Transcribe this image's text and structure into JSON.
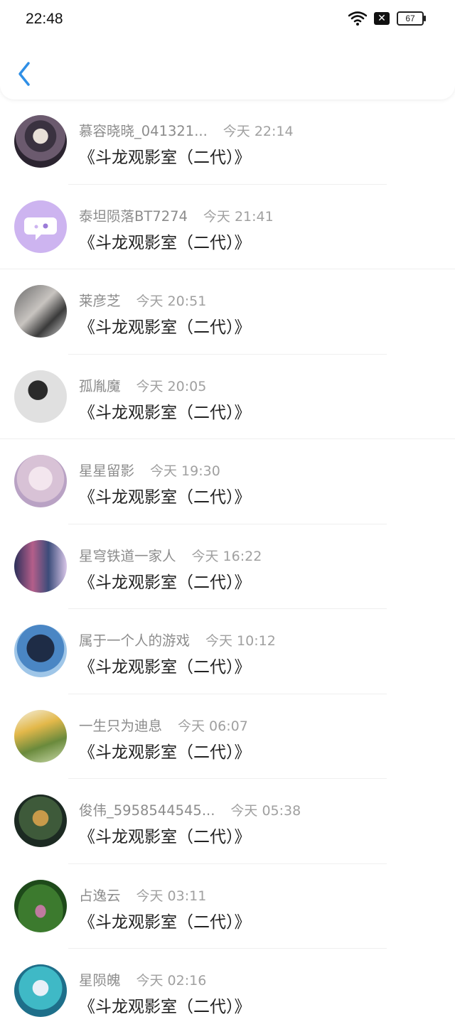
{
  "status_bar": {
    "time": "22:48",
    "battery": "67"
  },
  "header": {
    "back_icon": "chevron-left-icon",
    "accent_color": "#2f8fe6"
  },
  "comments": [
    {
      "name": "慕容晓晓_041321...",
      "time": "今天 22:14",
      "title": "《斗龙观影室（二代）》"
    },
    {
      "name": "泰坦陨落BT7274",
      "time": "今天 21:41",
      "title": "《斗龙观影室（二代）》"
    },
    {
      "name": "莱彦芝",
      "time": "今天 20:51",
      "title": "《斗龙观影室（二代）》"
    },
    {
      "name": "孤胤魔",
      "time": "今天 20:05",
      "title": "《斗龙观影室（二代）》"
    },
    {
      "name": "星星留影",
      "time": "今天 19:30",
      "title": "《斗龙观影室（二代）》"
    },
    {
      "name": "星穹铁道一家人",
      "time": "今天 16:22",
      "title": "《斗龙观影室（二代）》"
    },
    {
      "name": "属于一个人的游戏",
      "time": "今天 10:12",
      "title": "《斗龙观影室（二代）》"
    },
    {
      "name": "一生只为迪息",
      "time": "今天 06:07",
      "title": "《斗龙观影室（二代）》"
    },
    {
      "name": "俊伟_5958544545...",
      "time": "今天 05:38",
      "title": "《斗龙观影室（二代）》"
    },
    {
      "name": "占逸云",
      "time": "今天 03:11",
      "title": "《斗龙观影室（二代）》"
    },
    {
      "name": "星陨魄",
      "time": "今天 02:16",
      "title": "《斗龙观影室（二代）》"
    }
  ]
}
